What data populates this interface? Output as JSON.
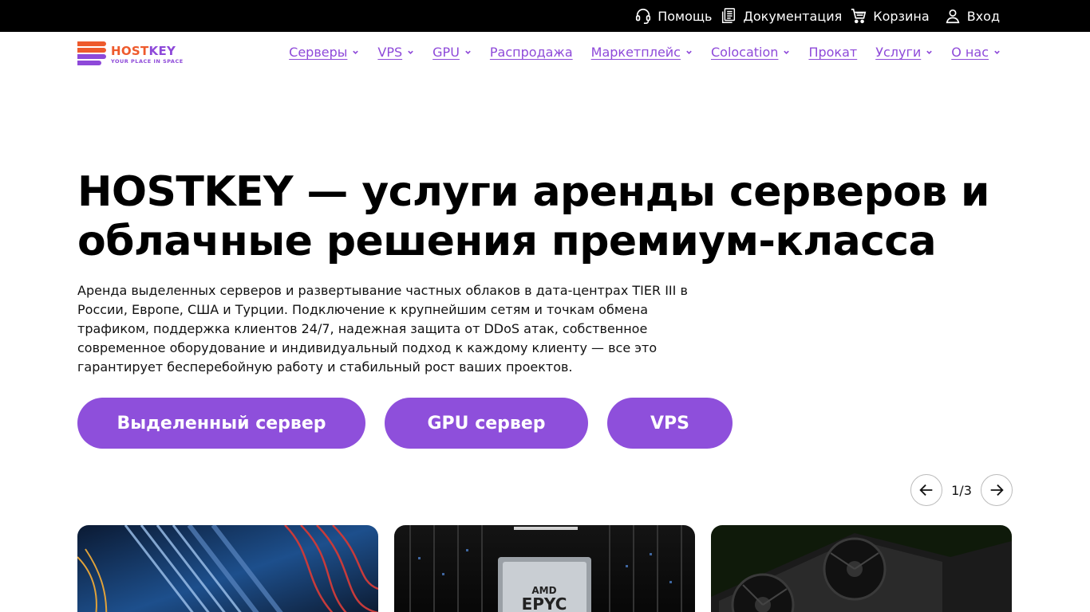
{
  "topbar": {
    "links": [
      {
        "label": "Помощь",
        "icon": "headset-icon"
      },
      {
        "label": "Документация",
        "icon": "documents-icon"
      },
      {
        "label": "Корзина",
        "icon": "cart-icon"
      },
      {
        "label": "Вход",
        "icon": "user-icon"
      }
    ]
  },
  "logo": {
    "name_part1": "HOST",
    "name_part2": "KEY",
    "tagline": "YOUR PLACE IN SPACE"
  },
  "nav": {
    "items": [
      {
        "label": "Серверы",
        "dropdown": true
      },
      {
        "label": "VPS",
        "dropdown": true
      },
      {
        "label": "GPU",
        "dropdown": true
      },
      {
        "label": "Распродажа",
        "dropdown": false
      },
      {
        "label": "Маркетплейс",
        "dropdown": true
      },
      {
        "label": "Colocation",
        "dropdown": true
      },
      {
        "label": "Прокат",
        "dropdown": false
      },
      {
        "label": "Услуги",
        "dropdown": true
      },
      {
        "label": "О нас",
        "dropdown": true
      }
    ]
  },
  "hero": {
    "title_line1": "HOSTKEY — услуги аренды серверов и",
    "title_line2": "облачные решения премиум-класса",
    "description": "Аренда выделенных серверов и развертывание частных облаков в дата-центрах TIER III в России, Европе, США и Турции. Подключение к крупнейшим сетям и точкам обмена трафиком, поддержка клиентов 24/7, надежная защита от DDoS атак, собственное современное оборудование и индивидуальный подход к каждому клиенту — все это гарантирует бесперебойную работу и стабильный рост ваших проектов.",
    "buttons": {
      "dedicated": "Выделенный сервер",
      "gpu": "GPU сервер",
      "vps": "VPS"
    }
  },
  "carousel": {
    "pager": "1/3",
    "cards": [
      {
        "image": "server-hardware-photo"
      },
      {
        "image": "amd-epyc-datacenter-photo",
        "chip_text_1": "AMD",
        "chip_text_2": "EPYC"
      },
      {
        "image": "gpu-card-photo"
      }
    ]
  },
  "colors": {
    "brand_purple": "#8e4fdb",
    "brand_orange": "#ee5a2c",
    "topbar_bg": "#000000"
  }
}
